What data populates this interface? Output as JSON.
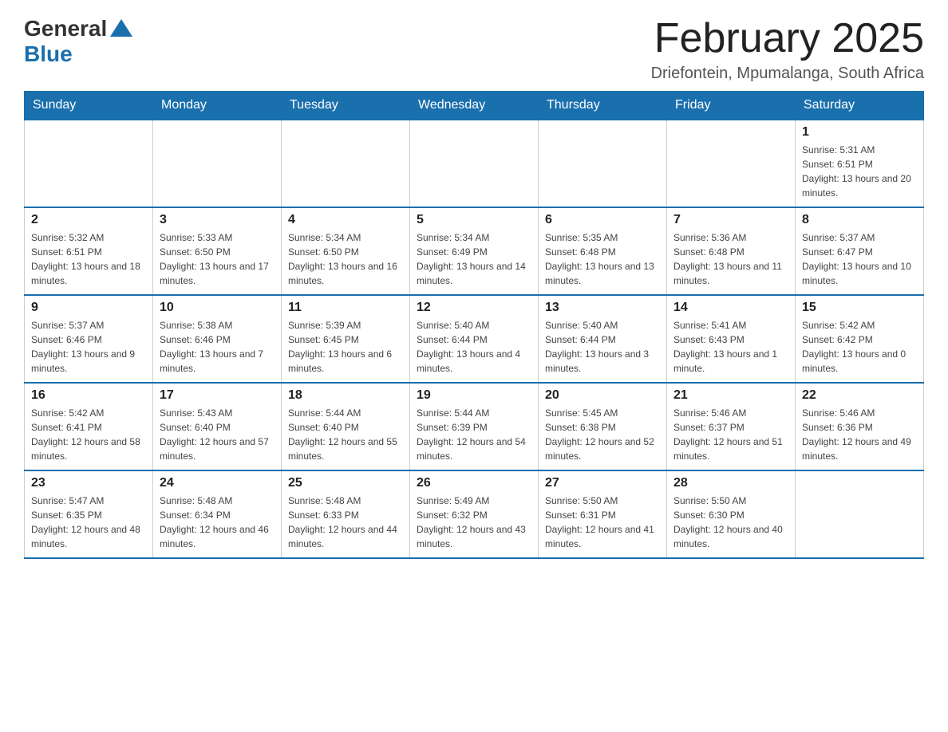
{
  "logo": {
    "general": "General",
    "blue": "Blue"
  },
  "title": "February 2025",
  "subtitle": "Driefontein, Mpumalanga, South Africa",
  "days_of_week": [
    "Sunday",
    "Monday",
    "Tuesday",
    "Wednesday",
    "Thursday",
    "Friday",
    "Saturday"
  ],
  "weeks": [
    [
      {
        "day": "",
        "info": ""
      },
      {
        "day": "",
        "info": ""
      },
      {
        "day": "",
        "info": ""
      },
      {
        "day": "",
        "info": ""
      },
      {
        "day": "",
        "info": ""
      },
      {
        "day": "",
        "info": ""
      },
      {
        "day": "1",
        "info": "Sunrise: 5:31 AM\nSunset: 6:51 PM\nDaylight: 13 hours and 20 minutes."
      }
    ],
    [
      {
        "day": "2",
        "info": "Sunrise: 5:32 AM\nSunset: 6:51 PM\nDaylight: 13 hours and 18 minutes."
      },
      {
        "day": "3",
        "info": "Sunrise: 5:33 AM\nSunset: 6:50 PM\nDaylight: 13 hours and 17 minutes."
      },
      {
        "day": "4",
        "info": "Sunrise: 5:34 AM\nSunset: 6:50 PM\nDaylight: 13 hours and 16 minutes."
      },
      {
        "day": "5",
        "info": "Sunrise: 5:34 AM\nSunset: 6:49 PM\nDaylight: 13 hours and 14 minutes."
      },
      {
        "day": "6",
        "info": "Sunrise: 5:35 AM\nSunset: 6:48 PM\nDaylight: 13 hours and 13 minutes."
      },
      {
        "day": "7",
        "info": "Sunrise: 5:36 AM\nSunset: 6:48 PM\nDaylight: 13 hours and 11 minutes."
      },
      {
        "day": "8",
        "info": "Sunrise: 5:37 AM\nSunset: 6:47 PM\nDaylight: 13 hours and 10 minutes."
      }
    ],
    [
      {
        "day": "9",
        "info": "Sunrise: 5:37 AM\nSunset: 6:46 PM\nDaylight: 13 hours and 9 minutes."
      },
      {
        "day": "10",
        "info": "Sunrise: 5:38 AM\nSunset: 6:46 PM\nDaylight: 13 hours and 7 minutes."
      },
      {
        "day": "11",
        "info": "Sunrise: 5:39 AM\nSunset: 6:45 PM\nDaylight: 13 hours and 6 minutes."
      },
      {
        "day": "12",
        "info": "Sunrise: 5:40 AM\nSunset: 6:44 PM\nDaylight: 13 hours and 4 minutes."
      },
      {
        "day": "13",
        "info": "Sunrise: 5:40 AM\nSunset: 6:44 PM\nDaylight: 13 hours and 3 minutes."
      },
      {
        "day": "14",
        "info": "Sunrise: 5:41 AM\nSunset: 6:43 PM\nDaylight: 13 hours and 1 minute."
      },
      {
        "day": "15",
        "info": "Sunrise: 5:42 AM\nSunset: 6:42 PM\nDaylight: 13 hours and 0 minutes."
      }
    ],
    [
      {
        "day": "16",
        "info": "Sunrise: 5:42 AM\nSunset: 6:41 PM\nDaylight: 12 hours and 58 minutes."
      },
      {
        "day": "17",
        "info": "Sunrise: 5:43 AM\nSunset: 6:40 PM\nDaylight: 12 hours and 57 minutes."
      },
      {
        "day": "18",
        "info": "Sunrise: 5:44 AM\nSunset: 6:40 PM\nDaylight: 12 hours and 55 minutes."
      },
      {
        "day": "19",
        "info": "Sunrise: 5:44 AM\nSunset: 6:39 PM\nDaylight: 12 hours and 54 minutes."
      },
      {
        "day": "20",
        "info": "Sunrise: 5:45 AM\nSunset: 6:38 PM\nDaylight: 12 hours and 52 minutes."
      },
      {
        "day": "21",
        "info": "Sunrise: 5:46 AM\nSunset: 6:37 PM\nDaylight: 12 hours and 51 minutes."
      },
      {
        "day": "22",
        "info": "Sunrise: 5:46 AM\nSunset: 6:36 PM\nDaylight: 12 hours and 49 minutes."
      }
    ],
    [
      {
        "day": "23",
        "info": "Sunrise: 5:47 AM\nSunset: 6:35 PM\nDaylight: 12 hours and 48 minutes."
      },
      {
        "day": "24",
        "info": "Sunrise: 5:48 AM\nSunset: 6:34 PM\nDaylight: 12 hours and 46 minutes."
      },
      {
        "day": "25",
        "info": "Sunrise: 5:48 AM\nSunset: 6:33 PM\nDaylight: 12 hours and 44 minutes."
      },
      {
        "day": "26",
        "info": "Sunrise: 5:49 AM\nSunset: 6:32 PM\nDaylight: 12 hours and 43 minutes."
      },
      {
        "day": "27",
        "info": "Sunrise: 5:50 AM\nSunset: 6:31 PM\nDaylight: 12 hours and 41 minutes."
      },
      {
        "day": "28",
        "info": "Sunrise: 5:50 AM\nSunset: 6:30 PM\nDaylight: 12 hours and 40 minutes."
      },
      {
        "day": "",
        "info": ""
      }
    ]
  ]
}
